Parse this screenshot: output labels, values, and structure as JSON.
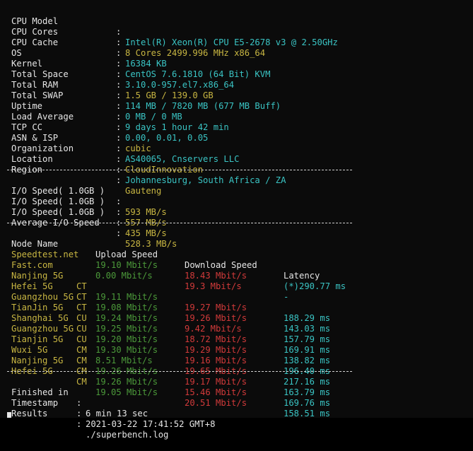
{
  "system_info": [
    {
      "key": "CPU Model",
      "value": "Intel(R) Xeon(R) CPU E5-2678 v3 @ 2.50GHz"
    },
    {
      "key": "CPU Cores",
      "value": "8 Cores 2499.996 MHz x86_64"
    },
    {
      "key": "CPU Cache",
      "value": "16384 KB"
    },
    {
      "key": "OS",
      "value": "CentOS 7.6.1810 (64 Bit) KVM"
    },
    {
      "key": "Kernel",
      "value": "3.10.0-957.el7.x86_64"
    },
    {
      "key": "Total Space",
      "value": "1.5 GB / 139.0 GB"
    },
    {
      "key": "Total RAM",
      "value": "114 MB / 7820 MB (677 MB Buff)"
    },
    {
      "key": "Total SWAP",
      "value": "0 MB / 0 MB"
    },
    {
      "key": "Uptime",
      "value": "9 days 1 hour 42 min"
    },
    {
      "key": "Load Average",
      "value": "0.00, 0.01, 0.05"
    },
    {
      "key": "TCP CC",
      "value": "cubic"
    },
    {
      "key": "ASN & ISP",
      "value": "AS40065, Cnservers LLC"
    },
    {
      "key": "Organization",
      "value": "CloudInnovation"
    },
    {
      "key": "Location",
      "value": "Johannesburg, South Africa / ZA"
    },
    {
      "key": "Region",
      "value": "Gauteng"
    }
  ],
  "io_tests": [
    {
      "key": "I/O Speed( 1.0GB )",
      "value": "593 MB/s"
    },
    {
      "key": "I/O Speed( 1.0GB )",
      "value": "557 MB/s"
    },
    {
      "key": "I/O Speed( 1.0GB )",
      "value": "435 MB/s"
    },
    {
      "key": "Average I/O Speed",
      "value": "528.3 MB/s"
    }
  ],
  "speed_headers": {
    "node": "Node Name",
    "upload": "Upload Speed",
    "download": "Download Speed",
    "latency": "Latency"
  },
  "speed_rows": [
    {
      "node": "Speedtest.net",
      "isp": "",
      "upload": "19.10 Mbit/s",
      "download": "18.43 Mbit/s",
      "latency": "(*)290.77 ms"
    },
    {
      "node": "Fast.com",
      "isp": "",
      "upload": "0.00 Mbit/s",
      "download": "19.3 Mbit/s",
      "latency": "-"
    },
    {
      "node": "Nanjing 5G",
      "isp": "CT",
      "upload": "19.11 Mbit/s",
      "download": "19.27 Mbit/s",
      "latency": "188.29 ms"
    },
    {
      "node": "Hefei 5G",
      "isp": "CT",
      "upload": "19.08 Mbit/s",
      "download": "19.26 Mbit/s",
      "latency": "143.03 ms"
    },
    {
      "node": "Guangzhou 5G",
      "isp": "CT",
      "upload": "19.24 Mbit/s",
      "download": "9.42 Mbit/s",
      "latency": "157.79 ms"
    },
    {
      "node": "TianJin 5G",
      "isp": "CU",
      "upload": "19.25 Mbit/s",
      "download": "18.72 Mbit/s",
      "latency": "169.91 ms"
    },
    {
      "node": "Shanghai 5G",
      "isp": "CU",
      "upload": "19.20 Mbit/s",
      "download": "19.29 Mbit/s",
      "latency": "138.82 ms"
    },
    {
      "node": "Guangzhou 5G",
      "isp": "CU",
      "upload": "19.30 Mbit/s",
      "download": "19.16 Mbit/s",
      "latency": "196.40 ms"
    },
    {
      "node": "Tianjin 5G",
      "isp": "CM",
      "upload": "8.51 Mbit/s",
      "download": "19.65 Mbit/s",
      "latency": "217.16 ms"
    },
    {
      "node": "Wuxi 5G",
      "isp": "CM",
      "upload": "19.26 Mbit/s",
      "download": "19.17 Mbit/s",
      "latency": "163.79 ms"
    },
    {
      "node": "Nanjing 5G",
      "isp": "CM",
      "upload": "19.26 Mbit/s",
      "download": "15.46 Mbit/s",
      "latency": "169.76 ms"
    },
    {
      "node": "Hefei 5G",
      "isp": "CM",
      "upload": "19.05 Mbit/s",
      "download": "20.51 Mbit/s",
      "latency": "158.51 ms"
    }
  ],
  "summary": [
    {
      "key": "Finished in",
      "value": "6 min 13 sec"
    },
    {
      "key": "Timestamp",
      "value": "2021-03-22 17:41:52 GMT+8"
    },
    {
      "key": "Results",
      "value": "./superbench.log"
    }
  ],
  "colors": {
    "background": "#0b0b0b",
    "text": "#e6e6e6",
    "cyan": "#3ac4c4",
    "yellow": "#c8b642",
    "green": "#4c9a3a",
    "red": "#d23a3a"
  }
}
